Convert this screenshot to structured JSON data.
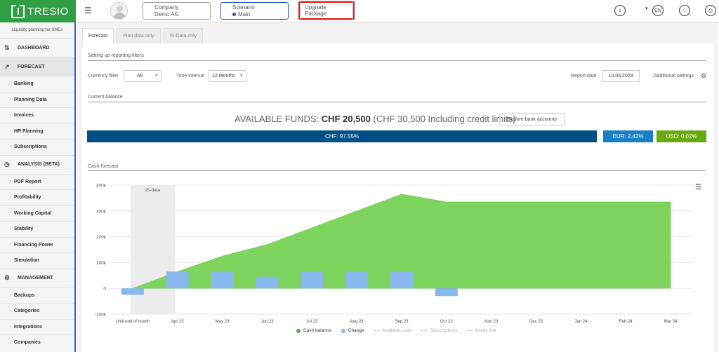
{
  "app": {
    "brand": "TRESIO",
    "tagline": "Liquidity planning for SMEs"
  },
  "header": {
    "company_label": "Company",
    "company_value": "Demo AG",
    "scenario_label": "Scenario",
    "scenario_value": "Main",
    "upgrade_label": "Upgrade Package",
    "language": "EN",
    "info_icon": "info-icon",
    "bell_icon": "bell-icon",
    "user_icon": "user-icon"
  },
  "sidebar": {
    "sections": [
      {
        "label": "DASHBOARD",
        "icon": "sliders-icon"
      },
      {
        "label": "FORECAST",
        "icon": "trend-icon",
        "active": true
      },
      {
        "label": "ANALYSIS (BETA)",
        "icon": "clock-icon"
      },
      {
        "label": "MANAGEMENT",
        "icon": "gear-icon"
      }
    ],
    "forecast_items": [
      "Banking",
      "Planning Data",
      "Invoices",
      "HR Planning",
      "Subscriptions"
    ],
    "analysis_items": [
      "PDF Report",
      "Profitability",
      "Working Capital",
      "Stability",
      "Financing Power",
      "Simulation"
    ],
    "management_items": [
      "Backups",
      "Categories",
      "Integrations",
      "Companies"
    ]
  },
  "tabs": [
    "Forecast",
    "Plan data only",
    "IS-Data only"
  ],
  "filters": {
    "section_title": "Setting up reporting filters",
    "currency_label": "Currency filter",
    "currency_value": "All",
    "interval_label": "Time interval",
    "interval_value": "12 Months",
    "report_date_label": "Report date",
    "report_date_value": "10.03.2023",
    "additional_settings": "Additional settings"
  },
  "balance": {
    "section_title": "Current balance",
    "available_label": "AVAILABLE FUNDS:",
    "available_value": "CHF 20,500",
    "including_text": "(CHF 30,500 Including credit limits)",
    "explore_button": "Explore bank accounts",
    "bars": [
      {
        "label": "CHF: 97.55%",
        "color": "#004f85"
      },
      {
        "label": "EUR: 2.42%",
        "color": "#1a7fc4"
      },
      {
        "label": "USD: 0.02%",
        "color": "#6aaa10"
      }
    ]
  },
  "chart_data": {
    "type": "area",
    "title": "Cash forecast",
    "categories": [
      "Until end of month",
      "Apr 23",
      "May 23",
      "Jun 23",
      "Jul 23",
      "Aug 23",
      "Sep 23",
      "Oct 23",
      "Nov 23",
      "Dec 23",
      "Jan 24",
      "Feb 24",
      "Mar 24"
    ],
    "ylim": [
      -100000,
      400000
    ],
    "yticks": [
      -100000,
      0,
      100000,
      200000,
      300000,
      400000
    ],
    "ytick_labels": [
      "-100k",
      "0",
      "100k",
      "200k",
      "300k",
      "400k"
    ],
    "band_label": "IS-data",
    "band_range": [
      0,
      1
    ],
    "series": [
      {
        "name": "Cash balance",
        "type": "area",
        "color": "#7fd35f",
        "values": [
          0,
          65000,
          125000,
          170000,
          235000,
          300000,
          365000,
          335000,
          335000,
          335000,
          335000,
          335000,
          335000
        ]
      },
      {
        "name": "Change",
        "type": "bar",
        "color": "#86b8ec",
        "values": [
          -25000,
          65000,
          65000,
          45000,
          65000,
          65000,
          65000,
          -30000,
          0,
          0,
          0,
          0,
          0
        ]
      }
    ],
    "legend": [
      {
        "name": "Cash balance",
        "color": "#4caf50",
        "style": "dot"
      },
      {
        "name": "Change",
        "color": "#86b8ec",
        "style": "dot"
      },
      {
        "name": "Available cash",
        "color": "#bbbbbb",
        "style": "dash"
      },
      {
        "name": "Subscriptions",
        "color": "#bbbbbb",
        "style": "dash"
      },
      {
        "name": "Credit line",
        "color": "#bbbbbb",
        "style": "dash"
      }
    ],
    "legend_position": "bottom-center"
  }
}
